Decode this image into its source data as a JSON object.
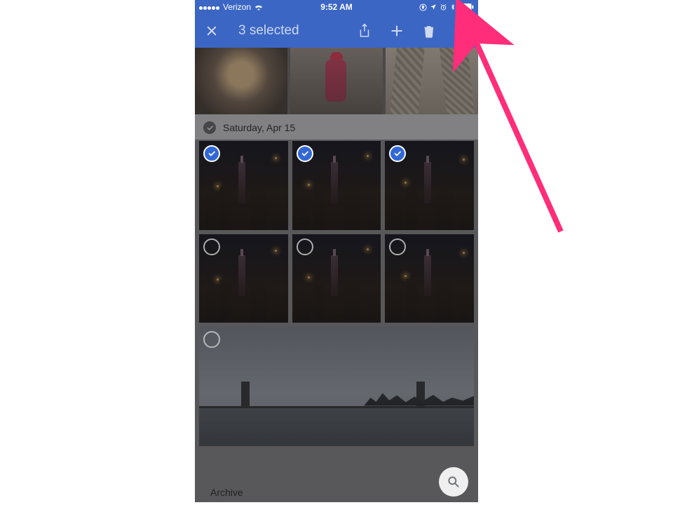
{
  "statusbar": {
    "carrier": "Verizon",
    "time": "9:52 AM"
  },
  "selection_bar": {
    "title": "3 selected"
  },
  "section": {
    "date_label": "Saturday, Apr 15"
  },
  "thumbs": {
    "row1": [
      {
        "selected": true
      },
      {
        "selected": true
      },
      {
        "selected": true
      }
    ],
    "row2": [
      {
        "selected": false
      },
      {
        "selected": false
      },
      {
        "selected": false
      }
    ]
  },
  "caption": "Archive",
  "icons": {
    "wifi": "wifi-icon",
    "lock": "orientation-lock-icon",
    "location": "location-icon",
    "alarm": "alarm-icon",
    "bt": "bluetooth-icon",
    "battery": "battery-icon",
    "close": "close-icon",
    "share": "share-icon",
    "add": "plus-icon",
    "trash": "trash-icon",
    "more": "more-icon",
    "check": "check-icon",
    "search": "search-icon"
  }
}
